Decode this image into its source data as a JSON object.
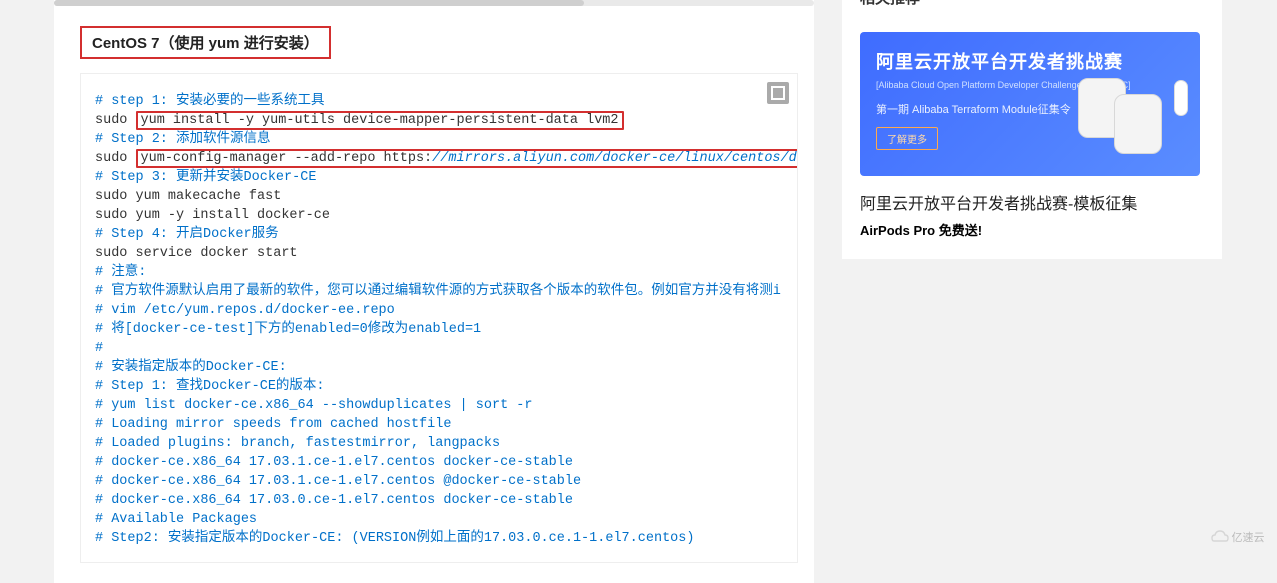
{
  "heading": "CentOS 7（使用 yum 进行安装）",
  "code": {
    "c_step1": "# step 1: 安装必要的一些系统工具",
    "l_sudo1a": "sudo ",
    "l_sudo1b": "yum install -y yum-utils device-mapper-persistent-data lvm2",
    "c_step2": "# Step 2: 添加软件源信息",
    "l_sudo2a": "sudo ",
    "l_sudo2b": "yum-config-manager --add-repo https:",
    "l_sudo2c": "//mirrors.aliyun.com/docker-ce/linux/centos/docker-",
    "c_step3": "# Step 3: 更新并安装Docker-CE",
    "l_makecache": "sudo yum makecache fast",
    "l_install": "sudo yum -y install docker-ce",
    "c_step4": "# Step 4: 开启Docker服务",
    "l_start": "sudo service docker start",
    "blank1": " ",
    "c_note": "# 注意:",
    "c_note2": "# 官方软件源默认启用了最新的软件，您可以通过编辑软件源的方式获取各个版本的软件包。例如官方并没有将测i",
    "c_vim": "# vim /etc/yum.repos.d/docker-ee.repo",
    "c_enable": "#   将[docker-ce-test]下方的enabled=0修改为enabled=1",
    "c_hash": "#",
    "c_installv": "# 安装指定版本的Docker-CE:",
    "c_step1b": "# Step 1: 查找Docker-CE的版本:",
    "c_yumlist": "# yum list docker-ce.x86_64 --showduplicates | sort -r",
    "c_loading": "#   Loading mirror speeds from cached hostfile",
    "c_loaded": "#   Loaded plugins: branch, fastestmirror, langpacks",
    "c_row1": "#   docker-ce.x86_64            17.03.1.ce-1.el7.centos            docker-ce-stable",
    "c_row2": "#   docker-ce.x86_64            17.03.1.ce-1.el7.centos            @docker-ce-stable",
    "c_row3": "#   docker-ce.x86_64            17.03.0.ce-1.el7.centos            docker-ce-stable",
    "c_avail": "#   Available Packages",
    "c_step2b": "# Step2: 安装指定版本的Docker-CE: (VERSION例如上面的17.03.0.ce.1-1.el7.centos)"
  },
  "sidebar": {
    "section_partial": "相关推荐",
    "banner_title": "阿里云开放平台开发者挑战赛",
    "banner_sub": "[Alibaba Cloud Open Platform Developer Challenge,简称AODC]",
    "banner_line": "第一期   Alibaba Terraform Module征集令",
    "banner_cta": "了解更多",
    "promo_title": "阿里云开放平台开发者挑战赛-模板征集",
    "promo_free": "AirPods Pro 免费送!"
  },
  "watermark": "亿速云"
}
